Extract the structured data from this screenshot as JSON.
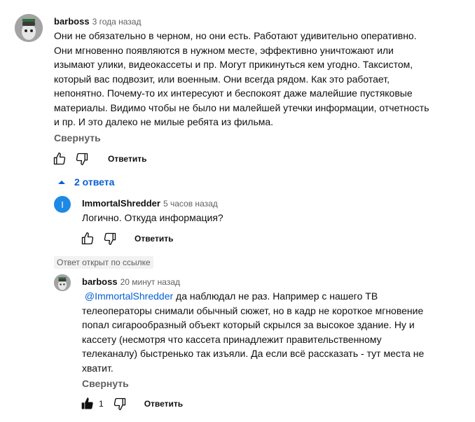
{
  "comment1": {
    "author": "barboss",
    "time": "3 года назад",
    "text_lines": [
      "Они не обязательно в черном, но они есть. Работают удивительно оперативно.",
      "Они мгновенно появляются в нужном месте, эффективно уничтожают или",
      "изымают улики, видеокассеты и пр. Могут прикинуться кем угодно. Таксистом,",
      "который вас подвозит, или военным. Они всегда рядом. Как это работает,",
      "непонятно. Почему-то их интересуют и беспокоят даже малейшие пустяковые",
      "материалы. Видимо чтобы не было ни малейшей утечки информации, отчетность",
      "и пр. И это далеко не милые ребята из фильма."
    ],
    "collapse_label": "Свернуть",
    "reply_label": "Ответить"
  },
  "replies_toggle": {
    "label": "2 ответа"
  },
  "reply1": {
    "avatar_letter": "I",
    "author": "ImmortalShredder",
    "time": "5 часов назад",
    "text": "Логично. Откуда информация?",
    "reply_label": "Ответить"
  },
  "linked_chip": {
    "label": "Ответ открыт по ссылке"
  },
  "reply2": {
    "author": "barboss",
    "time": "20 минут назад",
    "mention": "@ImmortalShredder",
    "first_line_rest": " да наблюдал не раз. Например с нашего ТВ",
    "text_lines": [
      "телеоператоры снимали обычный сюжет, но в кадр не короткое мгновение",
      "попал сигарообразный объект который скрылся за высокое здание. Ну и",
      "кассету (несмотря что кассета принадлежит правительственному",
      "телеканалу) быстренько так изъяли. Да если всё рассказать - тут места не",
      "хватит."
    ],
    "collapse_label": "Свернуть",
    "like_count": "1",
    "reply_label": "Ответить"
  },
  "colors": {
    "accent": "#065fd4",
    "avatar_blue": "#1e88e5",
    "secondary_text": "#606060"
  }
}
